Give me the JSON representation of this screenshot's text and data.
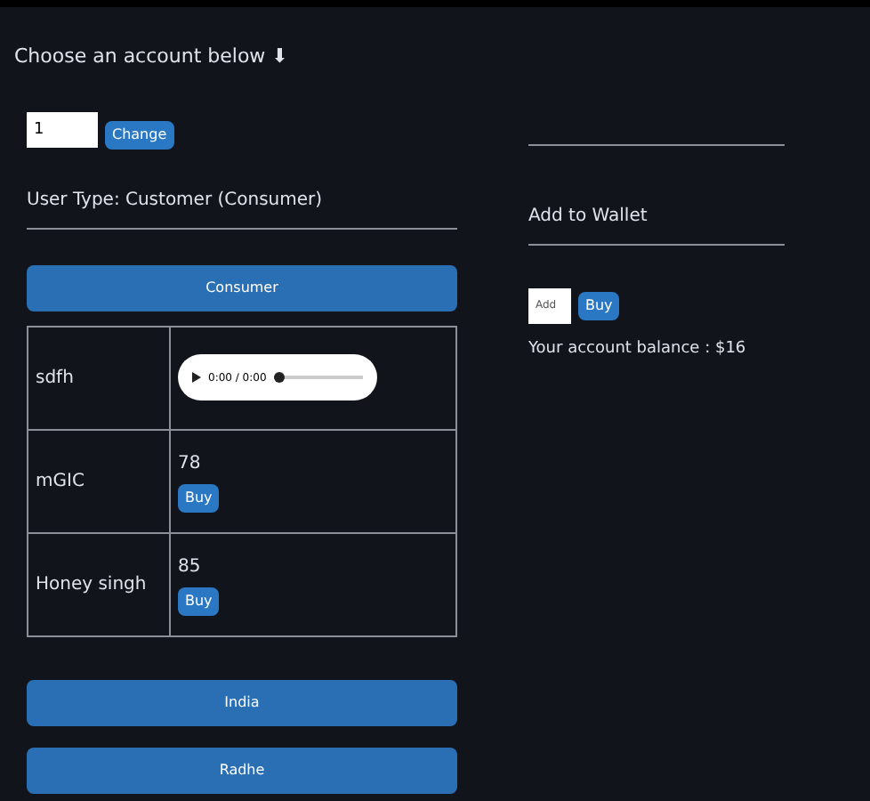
{
  "heading": "Choose an account below ⬇",
  "account_field": {
    "value": "1"
  },
  "change_button": "Change",
  "user_type": "User Type: Customer (Consumer)",
  "consumer_button": "Consumer",
  "rows": [
    {
      "kind": "audio",
      "name": "sdfh",
      "time": "0:00 / 0:00"
    },
    {
      "kind": "price",
      "name": "mGIC",
      "price": "78",
      "button": "Buy"
    },
    {
      "kind": "price",
      "name": "Honey singh",
      "price": "85",
      "button": "Buy"
    }
  ],
  "bottom_buttons": [
    "India",
    "Radhe"
  ],
  "wallet": {
    "title": "Add to Wallet",
    "field": {
      "placeholder": "Add"
    },
    "button": "Buy",
    "balance": "Your account balance : $16"
  }
}
